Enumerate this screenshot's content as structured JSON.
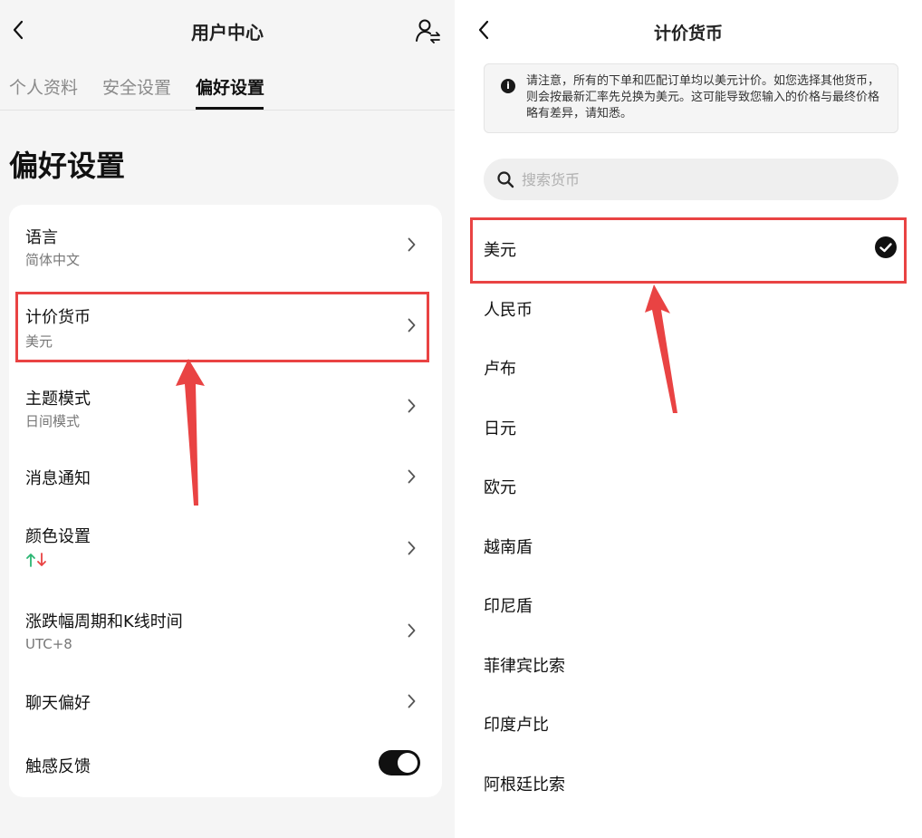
{
  "left": {
    "header_title": "用户中心",
    "tabs": [
      {
        "label": "个人资料"
      },
      {
        "label": "安全设置"
      },
      {
        "label": "偏好设置"
      }
    ],
    "page_title": "偏好设置",
    "items": [
      {
        "label": "语言",
        "sub": "简体中文"
      },
      {
        "label": "计价货币",
        "sub": "美元"
      },
      {
        "label": "主题模式",
        "sub": "日间模式"
      },
      {
        "label": "消息通知"
      },
      {
        "label": "颜色设置",
        "sub_icon": "up-green-down-red-arrows"
      },
      {
        "label": "涨跌幅周期和K线时间",
        "sub": "UTC+8"
      },
      {
        "label": "聊天偏好"
      },
      {
        "label": "触感反馈",
        "toggle_on": true
      }
    ]
  },
  "right": {
    "header_title": "计价货币",
    "notice": "请注意，所有的下单和匹配订单均以美元计价。如您选择其他货币，则会按最新汇率先兑换为美元。这可能导致您输入的价格与最终价格略有差异，请知悉。",
    "search_placeholder": "搜索货币",
    "currencies": [
      "美元",
      "人民币",
      "卢布",
      "日元",
      "欧元",
      "越南盾",
      "印尼盾",
      "菲律宾比索",
      "印度卢比",
      "阿根廷比索"
    ],
    "selected": "美元"
  },
  "colors": {
    "highlight": "#e94343",
    "up": "#2bb673",
    "down": "#e94343"
  }
}
